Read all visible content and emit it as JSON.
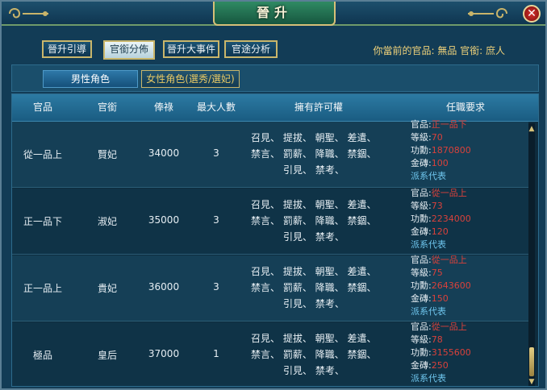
{
  "window": {
    "title": "晉升",
    "close_label": "✕"
  },
  "tabs": [
    {
      "label": "晉升引導",
      "active": false
    },
    {
      "label": "官銜分佈",
      "active": true
    },
    {
      "label": "晉升大事件",
      "active": false
    },
    {
      "label": "官途分析",
      "active": false
    }
  ],
  "rank_info": {
    "text": "你當前的官品: 無品  官銜: 庶人"
  },
  "subtabs": {
    "male": "男性角色",
    "female": "女性角色(選秀/選妃)"
  },
  "table": {
    "headers": [
      "官品",
      "官銜",
      "俸祿",
      "最大人數",
      "擁有許可權",
      "任職要求"
    ],
    "permissions": {
      "line1": "召見、  提拔、  朝聖、  差遣、",
      "line2": "禁言、  罰薪、  降職、  禁錮、",
      "line3": "引見、  禁考、"
    },
    "rows": [
      {
        "grade": "從一品上",
        "title": "賢妃",
        "salary": "34000",
        "max": "3",
        "req": [
          {
            "k": "官品:",
            "v": "正一品下"
          },
          {
            "k": "等級:",
            "v": "70"
          },
          {
            "k": "功勳:",
            "v": "1870800"
          },
          {
            "k": "金磚:",
            "v": "100"
          }
        ],
        "link": "派系代表"
      },
      {
        "grade": "正一品下",
        "title": "淑妃",
        "salary": "35000",
        "max": "3",
        "req": [
          {
            "k": "官品:",
            "v": "從一品上"
          },
          {
            "k": "等級:",
            "v": "73"
          },
          {
            "k": "功勳:",
            "v": "2234000"
          },
          {
            "k": "金磚:",
            "v": "120"
          }
        ],
        "link": "派系代表"
      },
      {
        "grade": "正一品上",
        "title": "貴妃",
        "salary": "36000",
        "max": "3",
        "req": [
          {
            "k": "官品:",
            "v": "從一品上"
          },
          {
            "k": "等級:",
            "v": "75"
          },
          {
            "k": "功勳:",
            "v": "2643600"
          },
          {
            "k": "金磚:",
            "v": "150"
          }
        ],
        "link": "派系代表"
      },
      {
        "grade": "極品",
        "title": "皇后",
        "salary": "37000",
        "max": "1",
        "req": [
          {
            "k": "官品:",
            "v": "從一品上"
          },
          {
            "k": "等級:",
            "v": "78"
          },
          {
            "k": "功勳:",
            "v": "3155600"
          },
          {
            "k": "金磚:",
            "v": "250"
          }
        ],
        "link": "派系代表"
      }
    ]
  },
  "colors": {
    "accent_gold": "#c9b66b",
    "requirement_value": "#d9413b",
    "link": "#6fc6ee",
    "rank_text": "#f0d27a"
  }
}
